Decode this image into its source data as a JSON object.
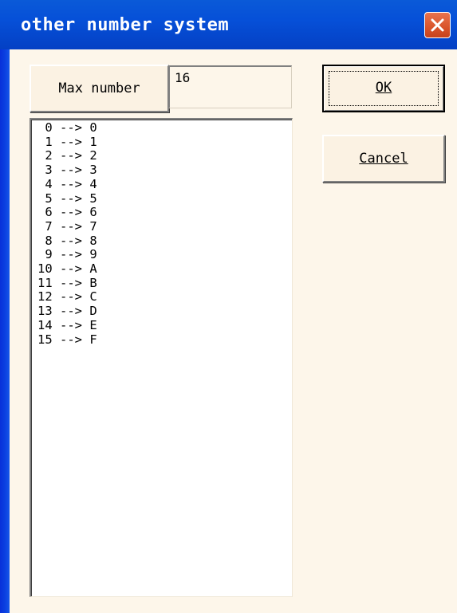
{
  "window": {
    "title": "other number system"
  },
  "colors": {
    "titlebar": "#0650d8",
    "client_bg": "#fdf6ea",
    "close_button": "#d9542b"
  },
  "icons": {
    "close": "close-icon"
  },
  "max_number": {
    "button_label": "Max number",
    "value": "16"
  },
  "buttons": {
    "ok_label": "OK",
    "cancel_label": "Cancel"
  },
  "list": {
    "items": [
      " 0 --> 0",
      " 1 --> 1",
      " 2 --> 2",
      " 3 --> 3",
      " 4 --> 4",
      " 5 --> 5",
      " 6 --> 6",
      " 7 --> 7",
      " 8 --> 8",
      " 9 --> 9",
      "10 --> A",
      "11 --> B",
      "12 --> C",
      "13 --> D",
      "14 --> E",
      "15 --> F"
    ]
  }
}
